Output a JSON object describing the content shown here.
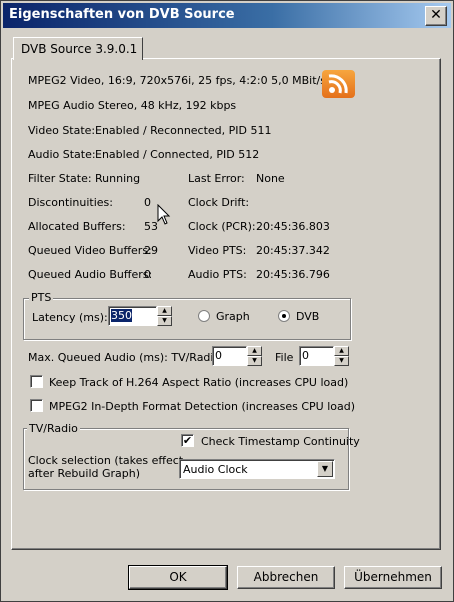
{
  "window": {
    "title": "Eigenschaften von DVB Source",
    "close_glyph": "✕"
  },
  "tab": {
    "label": "DVB Source 3.9.0.1"
  },
  "info": {
    "video_format": "MPEG2 Video, 16:9, 720x576i, 25 fps, 4:2:0   5,0 MBit/s",
    "audio_format": "MPEG Audio Stereo, 48 kHz, 192 kbps",
    "video_state_label": "Video State:",
    "video_state_value": "Enabled / Reconnected, PID 511",
    "audio_state_label": "Audio State:",
    "audio_state_value": "Enabled / Connected, PID 512",
    "filter_state_label": "Filter State:",
    "filter_state_value": "Running",
    "last_error_label": "Last Error:",
    "last_error_value": "None",
    "discontinuities_label": "Discontinuities:",
    "discontinuities_value": "0",
    "clock_drift_label": "Clock Drift:",
    "clock_drift_value": "",
    "allocated_buffers_label": "Allocated Buffers:",
    "allocated_buffers_value": "53",
    "clock_pcr_label": "Clock (PCR):",
    "clock_pcr_value": "20:45:36.803",
    "queued_video_label": "Queued Video Buffers:",
    "queued_video_value": "29",
    "video_pts_label": "Video PTS:",
    "video_pts_value": "20:45:37.342",
    "queued_audio_label": "Queued Audio Buffers:",
    "queued_audio_value": "0",
    "audio_pts_label": "Audio PTS:",
    "audio_pts_value": "20:45:36.796"
  },
  "pts": {
    "group_title": "PTS",
    "latency_label": "Latency (ms):",
    "latency_value": "350",
    "option_graph": "Graph",
    "option_dvb": "DVB",
    "selected": "DVB"
  },
  "audio_queue": {
    "label": "Max. Queued Audio (ms): TV/Radio",
    "tv_radio_value": "0",
    "file_label": "File",
    "file_value": "0"
  },
  "options": {
    "h264_aspect_label": "Keep Track of H.264 Aspect Ratio (increases CPU load)",
    "h264_aspect_checked": false,
    "mpeg2_detect_label": "MPEG2 In-Depth Format Detection (increases CPU load)",
    "mpeg2_detect_checked": false
  },
  "tvradio": {
    "group_title": "TV/Radio",
    "timestamp_label": "Check Timestamp Continuity",
    "timestamp_checked": true,
    "clock_label_line1": "Clock selection (takes effect",
    "clock_label_line2": "after Rebuild Graph)",
    "clock_value": "Audio Clock"
  },
  "buttons": {
    "ok": "OK",
    "cancel": "Abbrechen",
    "apply": "Übernehmen"
  },
  "icons": {
    "rss": "rss-feed-icon",
    "check": "✔"
  },
  "colors": {
    "titlebar_start": "#0a246a",
    "titlebar_end": "#a6caf0",
    "rss_orange": "#f0801f",
    "face": "#d4d0c8"
  }
}
